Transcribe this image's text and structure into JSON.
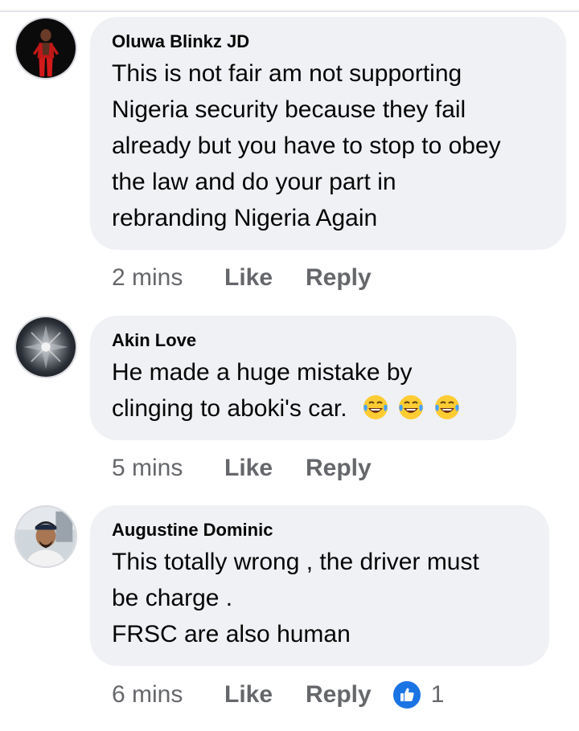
{
  "comments": [
    {
      "author": "Oluwa Blinkz JD",
      "text_lines": [
        "This is not fair am not supporting",
        "Nigeria security because they fail",
        "already but you have to stop to obey",
        "the law and do your part in",
        "rebranding Nigeria Again"
      ],
      "time": "2 mins",
      "like_label": "Like",
      "reply_label": "Reply"
    },
    {
      "author": "Akin Love",
      "text_lines": [
        "He made a huge mistake by",
        "clinging to aboki's car."
      ],
      "emojis": [
        "face-with-tears-of-joy-icon",
        "face-with-tears-of-joy-icon",
        "face-with-tears-of-joy-icon"
      ],
      "time": "5 mins",
      "like_label": "Like",
      "reply_label": "Reply"
    },
    {
      "author": "Augustine Dominic",
      "text_lines": [
        "This totally wrong , the driver must",
        "be charge .",
        "FRSC are also human"
      ],
      "time": "6 mins",
      "like_label": "Like",
      "reply_label": "Reply",
      "reaction_count": "1"
    }
  ],
  "colors": {
    "bubble": "#eff1f4",
    "meta_text": "#65676b",
    "like_badge": "#1b74e4"
  }
}
